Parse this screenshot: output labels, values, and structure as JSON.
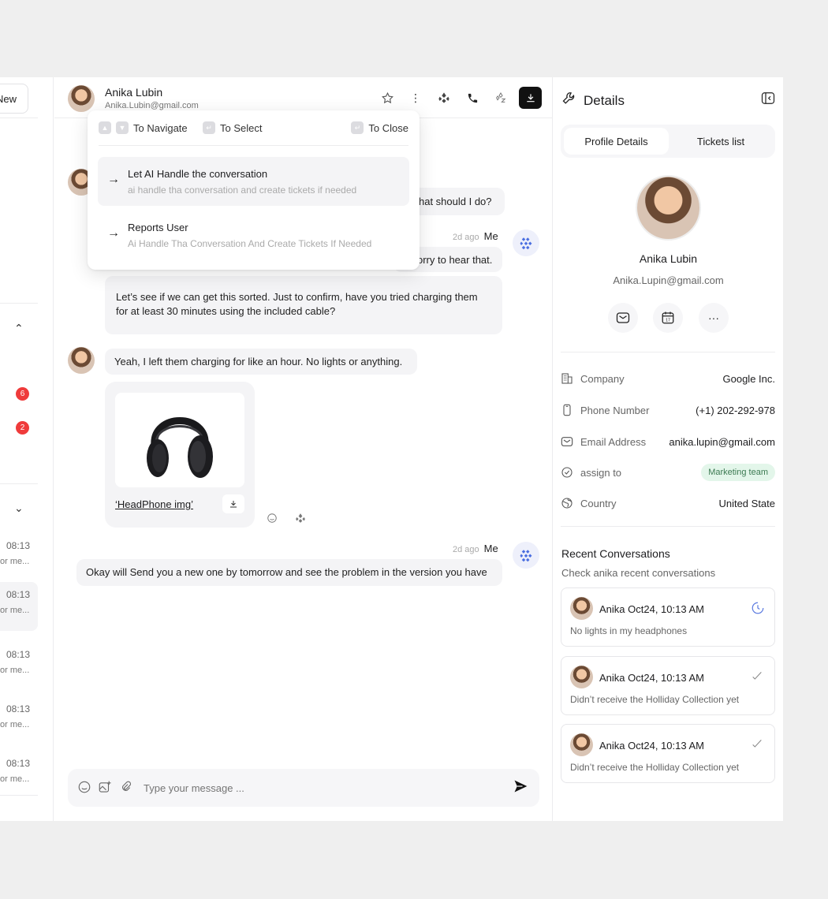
{
  "sidebar": {
    "new_label": "New",
    "badges": [
      "6",
      "2"
    ],
    "rows": [
      {
        "time": "08:13",
        "snip": "or me..."
      },
      {
        "time": "08:13",
        "snip": "or me..."
      },
      {
        "time": "08:13",
        "snip": "or me..."
      },
      {
        "time": "08:13",
        "snip": "or me..."
      },
      {
        "time": "08:13",
        "snip": "or me..."
      }
    ]
  },
  "header": {
    "name": "Anika Lubin",
    "email": "Anika.Lubin@gmail.com"
  },
  "popup": {
    "navigate": "To Navigate",
    "select": "To Select",
    "close": "To Close",
    "items": [
      {
        "title": "Let AI Handle the conversation",
        "desc": "ai handle tha conversation and create tickets if needed"
      },
      {
        "title": "Reports User",
        "desc": "Ai Handle Tha Conversation And Create Tickets If Needed"
      }
    ]
  },
  "messages": {
    "m1": "hat should I do?",
    "m2_meta": "2d ago",
    "me": "Me",
    "m2": "orry to hear that.",
    "m3": "Let’s see if we can get this sorted. Just to confirm, have you tried charging them for at least 30 minutes using the included cable?",
    "m4": "Yeah, I left them charging for like an hour. No lights or anything.",
    "image_label": "‘HeadPhone img’",
    "m5_meta": "2d ago",
    "m5": "Okay will Send you a new one by tomorrow and see the problem in the version you have"
  },
  "composer": {
    "placeholder": "Type your message ..."
  },
  "details": {
    "title": "Details",
    "tabs": [
      "Profile Details",
      "Tickets list"
    ],
    "name": "Anika Lubin",
    "email": "Anika.Lupin@gmail.com",
    "info": [
      {
        "key": "Company",
        "value": "Google Inc."
      },
      {
        "key": "Phone Number",
        "value": "(+1) 202-292-978"
      },
      {
        "key": "Email Address",
        "value": "anika.lupin@gmail.com"
      },
      {
        "key": "assign to",
        "value": "Marketing team"
      },
      {
        "key": "Country",
        "value": "United State"
      }
    ],
    "recent_title": "Recent Conversations",
    "recent_sub": "Check anika recent conversations",
    "conversations": [
      {
        "name": "Anika Oct24, 10:13 AM",
        "text": "No lights in my headphones",
        "status": "pending"
      },
      {
        "name": "Anika Oct24, 10:13 AM",
        "text": "Didn’t receive the Holliday Collection yet",
        "status": "done"
      },
      {
        "name": "Anika Oct24, 10:13 AM",
        "text": "Didn’t receive the Holliday Collection yet",
        "status": "done"
      }
    ]
  },
  "colors": {
    "accent": "#4a6ee0",
    "badge": "#ef3b3b",
    "pill_bg": "#e3f6ea"
  }
}
